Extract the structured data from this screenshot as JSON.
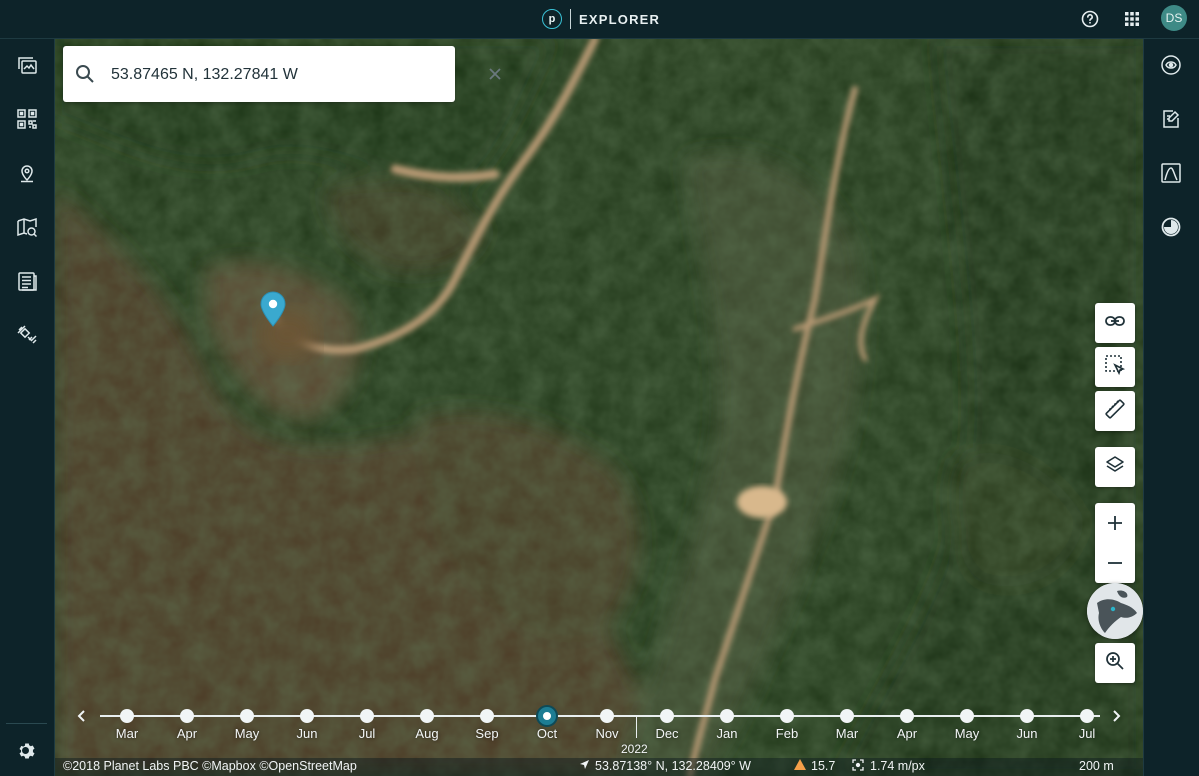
{
  "header": {
    "logo_letter": "p",
    "app_name": "EXPLORER",
    "avatar_initials": "DS",
    "icons": [
      "help-circle-icon",
      "apps-grid-icon"
    ]
  },
  "left_sidebar": {
    "icons": [
      "stacked-images-icon",
      "mosaic-grid-icon",
      "location-pin-icon",
      "map-search-icon",
      "list-document-icon",
      "satellite-pencil-icon",
      "settings-gear-icon"
    ]
  },
  "right_sidebar": {
    "icons": [
      "ndvi-analysis-icon",
      "add-analysis-icon",
      "elevation-profile-icon",
      "timelapse-compare-icon"
    ]
  },
  "search": {
    "value": "53.87465 N, 132.27841 W",
    "placeholder": ""
  },
  "map_controls": {
    "icons": [
      "link-icon",
      "area-select-icon",
      "ruler-icon",
      "layers-icon",
      "zoom-in-icon",
      "zoom-out-icon",
      "globe-minimap-icon",
      "zoom-search-icon"
    ]
  },
  "timeline": {
    "months": [
      "Mar",
      "Apr",
      "May",
      "Jun",
      "Jul",
      "Aug",
      "Sep",
      "Oct",
      "Nov",
      "Dec",
      "Jan",
      "Feb",
      "Mar",
      "Apr",
      "May",
      "Jun",
      "Jul"
    ],
    "selected_index": 7,
    "year_label": "2022"
  },
  "status": {
    "attribution": "©2018 Planet Labs PBC ©Mapbox ©OpenStreetMap",
    "cursor_coordinates": "53.87138° N, 132.28409° W",
    "cloud_value": "15.7",
    "resolution": "1.74 m/px",
    "scale": "200 m"
  },
  "colors": {
    "sidebar_bg": "#0d2329",
    "accent": "#3ac2d6",
    "marker": "#3aa9cf",
    "warning": "#f5a04a",
    "avatar": "#3e8a86"
  }
}
